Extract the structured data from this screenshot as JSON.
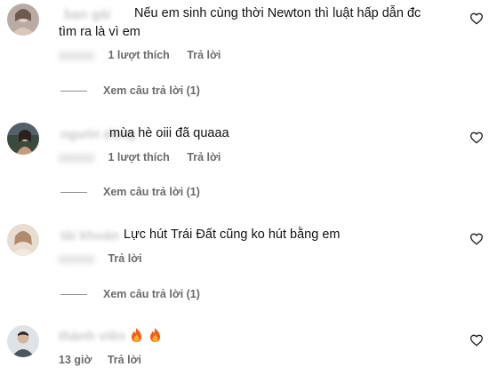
{
  "comments": [
    {
      "username": "bạn gái",
      "text_line1": "Nếu em sinh cùng thời Newton thì luật hấp dẫn đc",
      "text_line2": "tìm ra là vì em",
      "likes_label": "1 lượt thích",
      "reply_label": "Trả lời",
      "view_replies_label": "Xem câu trả lời (1)"
    },
    {
      "username": "người dùng",
      "text_line1": "mùa hè oiii đã quaaa",
      "likes_label": "1 lượt thích",
      "reply_label": "Trả lời",
      "view_replies_label": "Xem câu trả lời (1)"
    },
    {
      "username": "tài khoản",
      "text_line1": "Lực hút Trái Đất cũng ko hút bằng em",
      "reply_label": "Trả lời",
      "view_replies_label": "Xem câu trả lời (1)"
    },
    {
      "username": "thành viên",
      "time_label": "13 giờ",
      "reply_label": "Trả lời"
    }
  ],
  "icons": {
    "like": "heart-outline-icon",
    "emoji": "fire-emoji"
  },
  "colors": {
    "text": "#111111",
    "secondary": "#6b6b6b",
    "divider": "#8e8e8e",
    "fire": "#f35d14"
  }
}
